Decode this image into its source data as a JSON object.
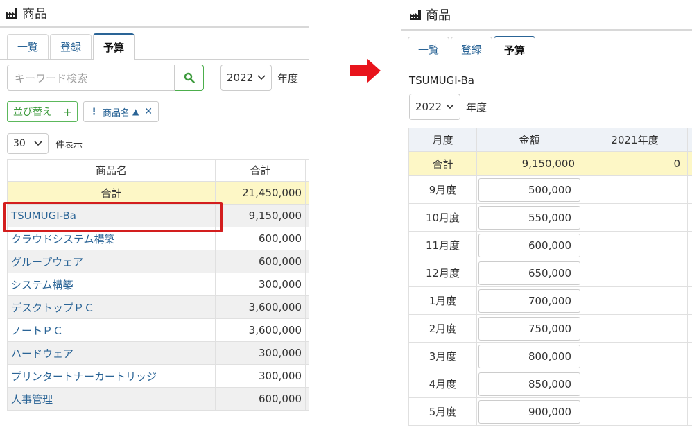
{
  "left": {
    "app_title": "商品",
    "tabs": [
      "一覧",
      "登録",
      "予算"
    ],
    "search": {
      "placeholder": "キーワード検索"
    },
    "year_select": "2022",
    "year_label": "年度",
    "sort": {
      "button_label": "並び替え",
      "add_label": "+",
      "chip_label": "商品名"
    },
    "per_page": {
      "value": "30",
      "label": "件表示"
    },
    "table": {
      "headers": [
        "商品名",
        "合計"
      ],
      "total_row": {
        "name": "合計",
        "amount": "21,450,000"
      },
      "rows": [
        {
          "name": "TSUMUGI-Ba",
          "amount": "9,150,000"
        },
        {
          "name": "クラウドシステム構築",
          "amount": "600,000"
        },
        {
          "name": "グループウェア",
          "amount": "600,000"
        },
        {
          "name": "システム構築",
          "amount": "300,000"
        },
        {
          "name": "デスクトップＰＣ",
          "amount": "3,600,000"
        },
        {
          "name": "ノートＰＣ",
          "amount": "3,600,000"
        },
        {
          "name": "ハードウェア",
          "amount": "300,000"
        },
        {
          "name": "プリンタートナーカートリッジ",
          "amount": "300,000"
        },
        {
          "name": "人事管理",
          "amount": "600,000"
        }
      ]
    }
  },
  "right": {
    "app_title": "商品",
    "tabs": [
      "一覧",
      "登録",
      "予算"
    ],
    "product_name": "TSUMUGI-Ba",
    "year_select": "2022",
    "year_label": "年度",
    "table": {
      "headers": [
        "月度",
        "金額",
        "2021年度"
      ],
      "total_row": {
        "month": "合計",
        "amount": "9,150,000",
        "prev": "0"
      },
      "rows": [
        {
          "month": "9月度",
          "amount": "500,000"
        },
        {
          "month": "10月度",
          "amount": "550,000"
        },
        {
          "month": "11月度",
          "amount": "600,000"
        },
        {
          "month": "12月度",
          "amount": "650,000"
        },
        {
          "month": "1月度",
          "amount": "700,000"
        },
        {
          "month": "2月度",
          "amount": "750,000"
        },
        {
          "month": "3月度",
          "amount": "800,000"
        },
        {
          "month": "4月度",
          "amount": "850,000"
        },
        {
          "month": "5月度",
          "amount": "900,000"
        }
      ]
    }
  },
  "colors": {
    "link": "#2a6496",
    "total_row_bg": "#fdf7c6",
    "highlight_border": "#d31e1e",
    "arrow": "#e8141c",
    "search_button": "#4cae4c"
  }
}
